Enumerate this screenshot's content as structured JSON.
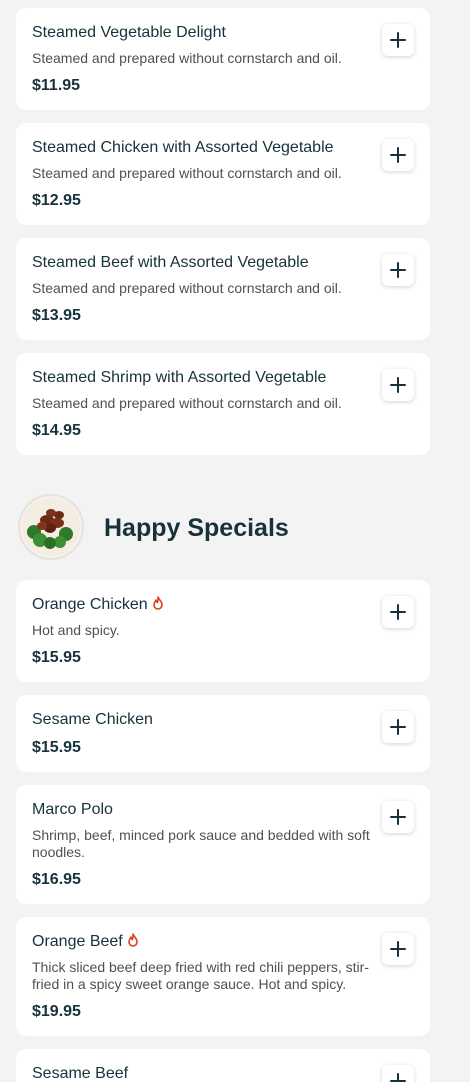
{
  "group_one": {
    "items": [
      {
        "name": "Steamed Vegetable Delight",
        "description": "Steamed and prepared without cornstarch and oil.",
        "price": "$11.95"
      },
      {
        "name": "Steamed Chicken with Assorted Vegetable",
        "description": "Steamed and prepared without cornstarch and oil.",
        "price": "$12.95"
      },
      {
        "name": "Steamed Beef with Assorted Vegetable",
        "description": "Steamed and prepared without cornstarch and oil.",
        "price": "$13.95"
      },
      {
        "name": "Steamed Shrimp with Assorted Vegetable",
        "description": "Steamed and prepared without cornstarch and oil.",
        "price": "$14.95"
      }
    ]
  },
  "happy_specials": {
    "title": "Happy Specials",
    "items": [
      {
        "name": "Orange Chicken",
        "spicy": true,
        "description": "Hot and spicy.",
        "price": "$15.95"
      },
      {
        "name": "Sesame Chicken",
        "spicy": false,
        "description": "",
        "price": "$15.95"
      },
      {
        "name": "Marco Polo",
        "spicy": false,
        "description": "Shrimp, beef, minced pork sauce and bedded with soft noodles.",
        "price": "$16.95"
      },
      {
        "name": "Orange Beef",
        "spicy": true,
        "description": "Thick sliced beef deep fried with red chili peppers, stir-fried in a spicy sweet orange sauce. Hot and spicy.",
        "price": "$19.95"
      },
      {
        "name": "Sesame Beef",
        "spicy": false,
        "description": "",
        "price": ""
      }
    ]
  },
  "icons": {
    "add": "plus-icon",
    "spicy": "flame-icon"
  },
  "colors": {
    "background": "#f3f3f3",
    "card": "#ffffff",
    "text": "#17323a",
    "spicy": "#d9431e"
  }
}
